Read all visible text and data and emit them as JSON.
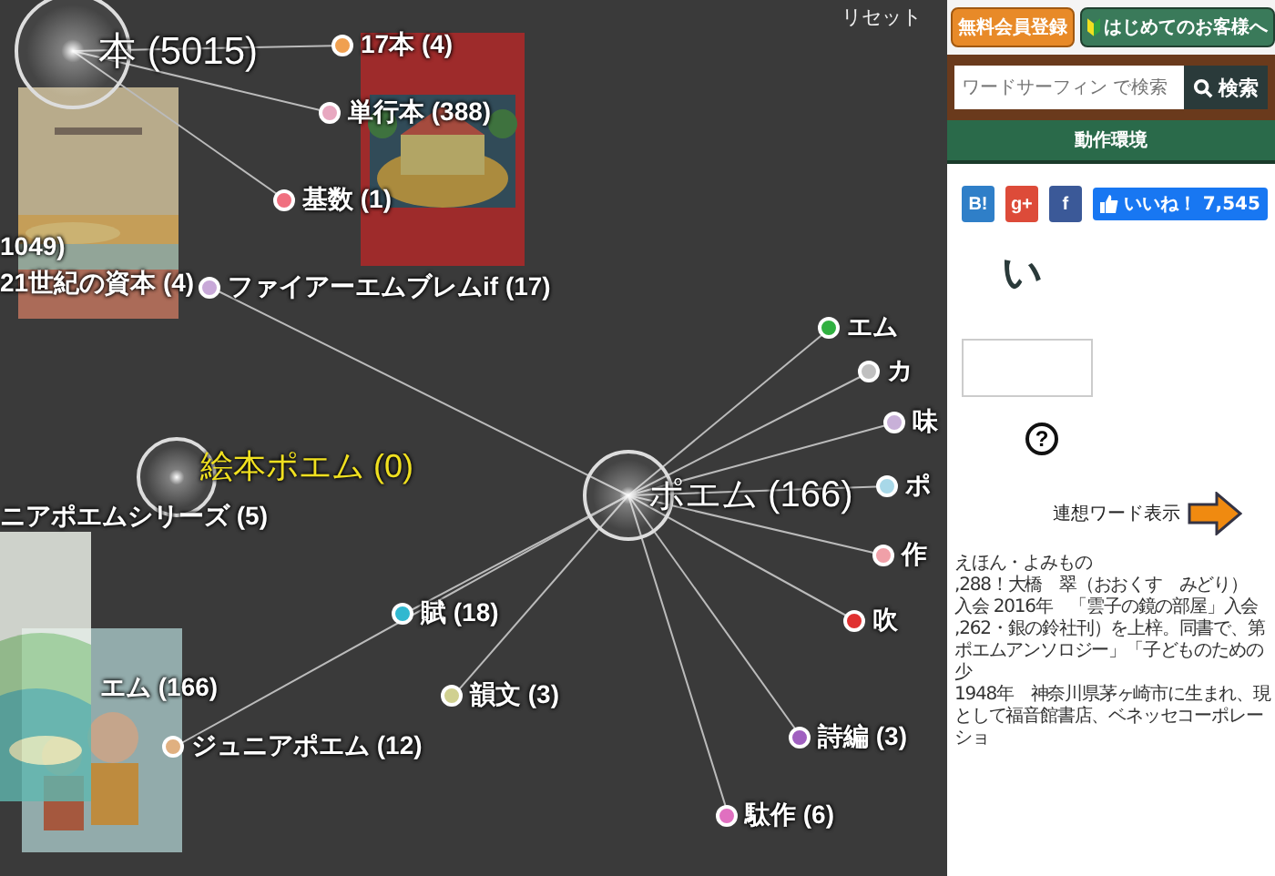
{
  "graph": {
    "reset": "リセット",
    "hubs": [
      {
        "label": "本 (5015)",
        "selected": false
      },
      {
        "label": "絵本ポエム (0)",
        "selected": true
      },
      {
        "label": "ポエム (166)",
        "selected": false
      }
    ],
    "nodes": [
      {
        "label": "17本 (4)",
        "color": "#f0a050"
      },
      {
        "label": "単行本 (388)",
        "color": "#e8a8c0"
      },
      {
        "label": "基数 (1)",
        "color": "#f07080"
      },
      {
        "label": "1049)"
      },
      {
        "label": "21世紀の資本 (4)"
      },
      {
        "label": "ファイアーエムブレムif (17)",
        "color": "#c8a8d8"
      },
      {
        "label": "ニアポエムシリーズ (5)"
      },
      {
        "label": "エム (166)"
      },
      {
        "label": "賦 (18)",
        "color": "#30b8d0"
      },
      {
        "label": "韻文 (3)",
        "color": "#d0d090"
      },
      {
        "label": "ジュニアポエム (12)",
        "color": "#e0b080"
      },
      {
        "label": "エム",
        "color": "#30b040"
      },
      {
        "label": "カ",
        "color": "#c0c0c0"
      },
      {
        "label": "味",
        "color": "#c8b0d8"
      },
      {
        "label": "ポ",
        "color": "#a8d8e8"
      },
      {
        "label": "作",
        "color": "#f0a0a8"
      },
      {
        "label": "吹",
        "color": "#e03030"
      },
      {
        "label": "詩編 (3)",
        "color": "#a060c0"
      },
      {
        "label": "駄作 (6)",
        "color": "#e070c0"
      }
    ]
  },
  "header": {
    "register": "無料会員登録",
    "guide": "はじめてのお客様へ"
  },
  "search": {
    "placeholder": "ワードサーフィン で検索",
    "button": "検索"
  },
  "nav": [
    "動作環境"
  ],
  "share": [
    {
      "kind": "hatena",
      "label": "B!"
    },
    {
      "kind": "google",
      "label": "g+"
    },
    {
      "kind": "facebook",
      "label": "f"
    }
  ],
  "like": {
    "label": "いいね！",
    "count": "7,545"
  },
  "heading": "い",
  "help": "?",
  "toggle": "連想ワード表示",
  "article": [
    "えほん・よみもの",
    ",288！大橋　翠（おおくす　みどり）",
    "入会 2016年　「雲子の鏡の部屋」入会",
    ",262・銀の鈴社刊）を上梓。同書で、第",
    "ポエムアンソロジー」「子どものための少",
    "1948年　神奈川県茅ヶ崎市に生まれ、現",
    "として福音館書店、ベネッセコーポレーショ"
  ]
}
